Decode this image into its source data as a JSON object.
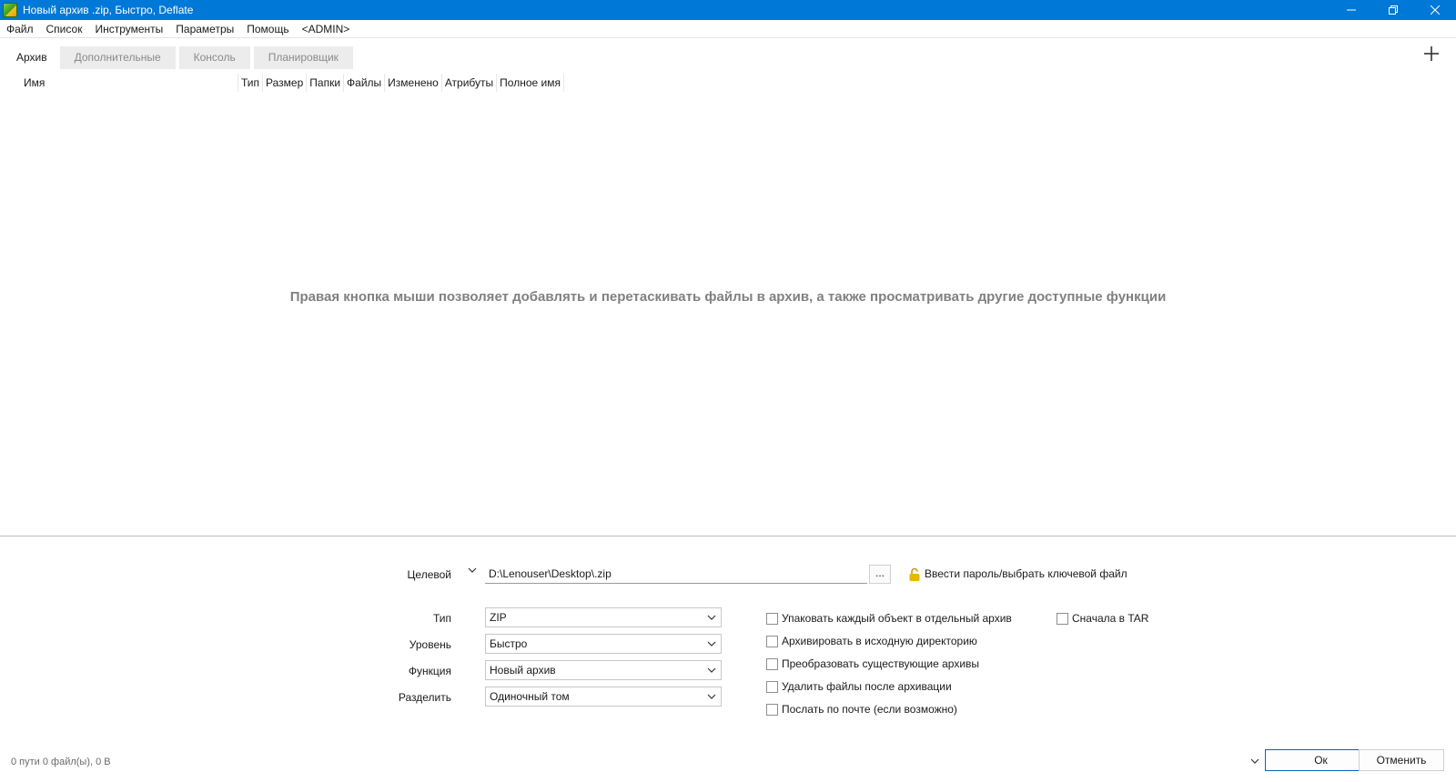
{
  "window": {
    "title": "Новый архив .zip, Быстро, Deflate",
    "controls": [
      "minimize-icon",
      "restore-icon",
      "close-icon"
    ]
  },
  "menu": {
    "items": [
      "Файл",
      "Список",
      "Инструменты",
      "Параметры",
      "Помощь",
      "<ADMIN>"
    ]
  },
  "tabs": [
    "Архив",
    "Дополнительные",
    "Консоль",
    "Планировщик"
  ],
  "active_tab": "Архив",
  "columns": [
    "Имя",
    "Тип",
    "Размер",
    "Папки",
    "Файлы",
    "Изменено",
    "Атрибуты",
    "Полное имя"
  ],
  "hint": "Правая кнопка мыши позволяет добавлять и перетаскивать файлы в архив, а также просматривать другие доступные функции",
  "form": {
    "target_label": "Целевой",
    "target_path": "D:\\Lenouser\\Desktop\\.zip",
    "browse_label": "...",
    "password_link": "Ввести пароль/выбрать ключевой файл",
    "type_label": "Тип",
    "type_value": "ZIP",
    "level_label": "Уровень",
    "level_value": "Быстро",
    "function_label": "Функция",
    "function_value": "Новый архив",
    "split_label": "Разделить",
    "split_value": "Одиночный том"
  },
  "options": [
    {
      "label": "Упаковать каждый объект в отдельный архив",
      "checked": false
    },
    {
      "label": "Архивировать в исходную директорию",
      "checked": false
    },
    {
      "label": "Преобразовать существующие архивы",
      "checked": false
    },
    {
      "label": "Удалить файлы после архивации",
      "checked": false
    },
    {
      "label": "Послать по почте (если возможно)",
      "checked": false
    }
  ],
  "tar_option": {
    "label": "Сначала в TAR",
    "checked": false
  },
  "status": "0 пути 0 файл(ы), 0 B",
  "buttons": {
    "ok": "Ок",
    "cancel": "Отменить"
  },
  "colors": {
    "titlebar": "#0078d7",
    "accent_button_border": "#0067c0",
    "lock": "#e6b800"
  }
}
